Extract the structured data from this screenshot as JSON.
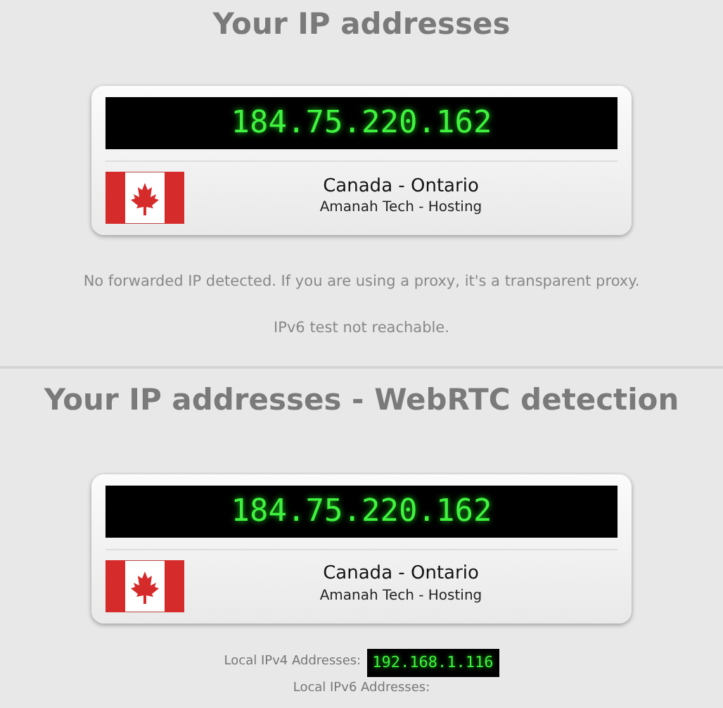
{
  "sections": [
    {
      "title": "Your IP addresses",
      "ip": "184.75.220.162",
      "location": "Canada - Ontario",
      "isp": "Amanah Tech - Hosting",
      "notes": [
        "No forwarded IP detected. If you are using a proxy, it's a transparent proxy.",
        "IPv6 test not reachable."
      ]
    },
    {
      "title": "Your IP addresses - WebRTC detection",
      "ip": "184.75.220.162",
      "location": "Canada - Ontario",
      "isp": "Amanah Tech - Hosting",
      "local": [
        {
          "label": "Local IPv4 Addresses:",
          "value": "192.168.1.116"
        },
        {
          "label": "Local IPv6 Addresses:"
        }
      ]
    }
  ]
}
